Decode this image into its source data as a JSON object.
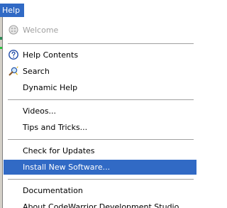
{
  "menubar": {
    "help_label": "Help"
  },
  "menu": {
    "welcome": "Welcome",
    "help_contents": "Help Contents",
    "search": "Search",
    "dynamic_help": "Dynamic Help",
    "videos": "Videos...",
    "tips_and_tricks": "Tips and Tricks...",
    "check_for_updates": "Check for Updates",
    "install_new_software": "Install New Software...",
    "documentation": "Documentation",
    "about": "About CodeWarrior Development Studio"
  },
  "colors": {
    "highlight": "#316ac5",
    "separator": "#a0a0a0",
    "disabled_text": "#a0a0a0"
  },
  "icons": {
    "welcome": "welcome-icon",
    "help_contents": "help-contents-icon",
    "search": "search-icon"
  }
}
